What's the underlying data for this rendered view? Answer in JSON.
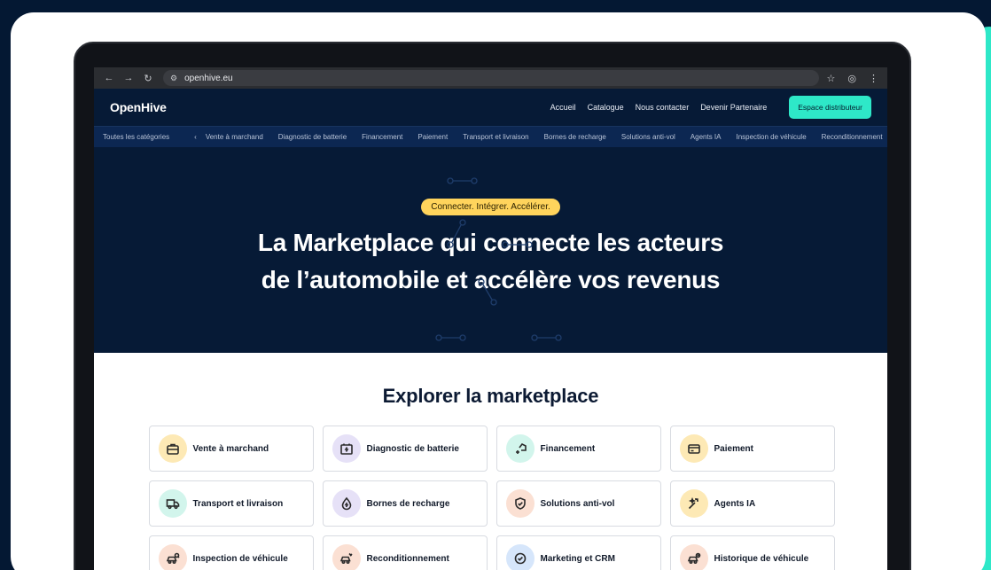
{
  "browser": {
    "url": "openhive.eu",
    "nav": {
      "back": "←",
      "forward": "→",
      "reload": "↻"
    },
    "actions": {
      "star": "☆",
      "profile": "◎",
      "menu": "⋮"
    }
  },
  "site": {
    "logo": "OpenHive",
    "nav": [
      "Accueil",
      "Catalogue",
      "Nous contacter",
      "Devenir Partenaire"
    ],
    "cta": "Espace distributeur"
  },
  "categories": {
    "all_label": "Toutes les catégories",
    "prev": "‹",
    "next": "›",
    "items": [
      "Vente à marchand",
      "Diagnostic de batterie",
      "Financement",
      "Paiement",
      "Transport et livraison",
      "Bornes de recharge",
      "Solutions anti-vol",
      "Agents IA",
      "Inspection de véhicule",
      "Reconditionnement"
    ]
  },
  "hero": {
    "pill": "Connecter. Intégrer. Accélérer.",
    "title_line1": "La Marketplace qui connecte les acteurs",
    "title_line2": "de l’automobile et accélère vos revenus"
  },
  "explore": {
    "title": "Explorer la marketplace",
    "tiles": [
      {
        "label": "Vente à marchand",
        "icon": "briefcase-icon",
        "color": "#fde9b5"
      },
      {
        "label": "Diagnostic de batterie",
        "icon": "battery-icon",
        "color": "#e6e1f7"
      },
      {
        "label": "Financement",
        "icon": "finance-icon",
        "color": "#d2f5ec"
      },
      {
        "label": "Paiement",
        "icon": "card-icon",
        "color": "#fde9b5"
      },
      {
        "label": "Transport et livraison",
        "icon": "truck-icon",
        "color": "#d2f5ec"
      },
      {
        "label": "Bornes de recharge",
        "icon": "charge-icon",
        "color": "#e6e1f7"
      },
      {
        "label": "Solutions anti-vol",
        "icon": "shield-icon",
        "color": "#fbe0d3"
      },
      {
        "label": "Agents IA",
        "icon": "ai-icon",
        "color": "#fde9b5"
      },
      {
        "label": "Inspection de véhicule",
        "icon": "car-inspect-icon",
        "color": "#fbe0d3"
      },
      {
        "label": "Reconditionnement",
        "icon": "car-repair-icon",
        "color": "#fbe0d3"
      },
      {
        "label": "Marketing et CRM",
        "icon": "check-badge-icon",
        "color": "#d6e6fb"
      },
      {
        "label": "Historique de véhicule",
        "icon": "car-history-icon",
        "color": "#fbe0d3"
      }
    ]
  }
}
